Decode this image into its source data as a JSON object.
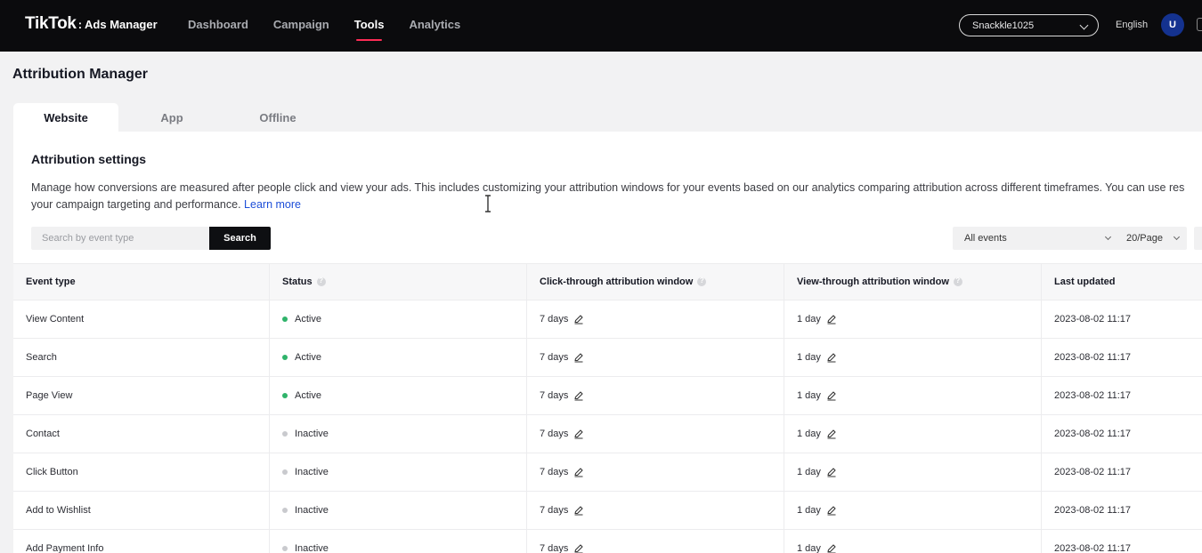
{
  "header": {
    "logo_main": "TikTok",
    "logo_sep": ":",
    "logo_sub": "Ads Manager",
    "nav": [
      {
        "label": "Dashboard"
      },
      {
        "label": "Campaign"
      },
      {
        "label": "Tools"
      },
      {
        "label": "Analytics"
      }
    ],
    "active_nav": "Tools",
    "account": "Snackkle1025",
    "language": "English",
    "avatar_initial": "U"
  },
  "page": {
    "title": "Attribution Manager",
    "tabs": [
      {
        "label": "Website"
      },
      {
        "label": "App"
      },
      {
        "label": "Offline"
      }
    ],
    "active_tab": "Website"
  },
  "settings": {
    "title": "Attribution settings",
    "description_line1": "Manage how conversions are measured after people click and view your ads. This includes customizing your attribution windows for your events based on our analytics comparing attribution across different timeframes. You can use res",
    "description_line2": "your campaign targeting and performance.",
    "learn_more": "Learn more"
  },
  "search": {
    "placeholder": "Search by event type",
    "button": "Search"
  },
  "filters": {
    "events": "All events",
    "page_size": "20/Page"
  },
  "table": {
    "columns": [
      "Event type",
      "Status",
      "Click-through attribution window",
      "View-through attribution window",
      "Last updated"
    ],
    "rows": [
      {
        "event": "View Content",
        "status": "Active",
        "click": "7 days",
        "view": "1 day",
        "updated": "2023-08-02 11:17"
      },
      {
        "event": "Search",
        "status": "Active",
        "click": "7 days",
        "view": "1 day",
        "updated": "2023-08-02 11:17"
      },
      {
        "event": "Page View",
        "status": "Active",
        "click": "7 days",
        "view": "1 day",
        "updated": "2023-08-02 11:17"
      },
      {
        "event": "Contact",
        "status": "Inactive",
        "click": "7 days",
        "view": "1 day",
        "updated": "2023-08-02 11:17"
      },
      {
        "event": "Click Button",
        "status": "Inactive",
        "click": "7 days",
        "view": "1 day",
        "updated": "2023-08-02 11:17"
      },
      {
        "event": "Add to Wishlist",
        "status": "Inactive",
        "click": "7 days",
        "view": "1 day",
        "updated": "2023-08-02 11:17"
      },
      {
        "event": "Add Payment Info",
        "status": "Inactive",
        "click": "7 days",
        "view": "1 day",
        "updated": "2023-08-02 11:17"
      }
    ]
  },
  "colors": {
    "active_dot": "#2fb36a",
    "inactive_dot": "#c9cace",
    "accent": "#fe2c55",
    "link": "#1d4ed8"
  }
}
